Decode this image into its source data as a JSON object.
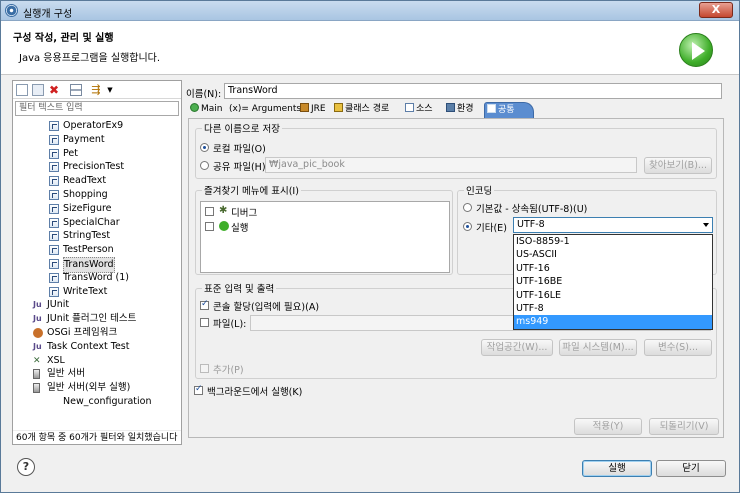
{
  "window": {
    "title": "실행개 구성",
    "close_label": "X"
  },
  "header": {
    "title": "구성 작성, 관리 및 실행",
    "subtitle": "Java 응용프로그램을 실행합니다."
  },
  "left": {
    "filter_placeholder": "필터 텍스트 입력",
    "items": [
      {
        "label": "OperatorEx9",
        "type": "java"
      },
      {
        "label": "Payment",
        "type": "java"
      },
      {
        "label": "Pet",
        "type": "java"
      },
      {
        "label": "PrecisionTest",
        "type": "java"
      },
      {
        "label": "ReadText",
        "type": "java"
      },
      {
        "label": "Shopping",
        "type": "java"
      },
      {
        "label": "SizeFigure",
        "type": "java"
      },
      {
        "label": "SpecialChar",
        "type": "java"
      },
      {
        "label": "StringTest",
        "type": "java"
      },
      {
        "label": "TestPerson",
        "type": "java"
      },
      {
        "label": "TransWord",
        "type": "java",
        "selected": true
      },
      {
        "label": "TransWord (1)",
        "type": "java"
      },
      {
        "label": "WriteText",
        "type": "java"
      },
      {
        "label": "JUnit",
        "type": "junit",
        "top": true
      },
      {
        "label": "JUnit 플러그인 테스트",
        "type": "junit-plugin",
        "top": true
      },
      {
        "label": "OSGi 프레임워크",
        "type": "osgi",
        "top": true
      },
      {
        "label": "Task Context Test",
        "type": "junit",
        "top": true
      },
      {
        "label": "XSL",
        "type": "xsl",
        "top": true
      },
      {
        "label": "일반 서버",
        "type": "server",
        "top": true
      },
      {
        "label": "일반 서버(외부 실행)",
        "type": "server",
        "top": true
      },
      {
        "label": "New_configuration",
        "type": "server-child"
      }
    ],
    "status": "60개 항목 중 60개가 필터와 일치했습니다"
  },
  "config": {
    "name_label": "이름(N):",
    "name_value": "TransWord",
    "tabs": [
      "Main",
      "(x)= Arguments",
      "JRE",
      "클래스 경로",
      "소스",
      "환경",
      "공통"
    ],
    "active_tab": 6,
    "save_as": {
      "legend": "다른 이름으로 저장",
      "local_label": "로컬 파일(O)",
      "shared_label": "공유 파일(H):",
      "shared_path": "₩java_pic_book",
      "browse_label": "찾아보기(B)..."
    },
    "favorites": {
      "legend": "즐겨찾기 메뉴에 표시(I)",
      "items": [
        {
          "label": "디버그",
          "icon": "debug-icon",
          "checked": false
        },
        {
          "label": "실행",
          "icon": "run-icon",
          "checked": false
        }
      ]
    },
    "encoding": {
      "legend": "인코딩",
      "default_label": "기본값 - 상속됨(UTF-8)(U)",
      "other_label": "기타(E)",
      "selected": "UTF-8",
      "options": [
        "ISO-8859-1",
        "US-ASCII",
        "UTF-16",
        "UTF-16BE",
        "UTF-16LE",
        "UTF-8",
        "ms949"
      ],
      "highlighted": "ms949"
    },
    "stdio": {
      "legend": "표준 입력 및 출력",
      "console_label": "콘솔 할당(입력에 필요)(A)",
      "file_label": "파일(L):",
      "workspace_label": "작업공간(W)...",
      "filesystem_label": "파일 시스템(M)...",
      "variables_label": "변수(S)...",
      "append_label": "추가(P)"
    },
    "background_label": "백그라운드에서 실행(K)",
    "apply_label": "적용(Y)",
    "revert_label": "되돌리기(V)"
  },
  "footer": {
    "help_label": "?",
    "run_label": "실행",
    "close_label": "닫기"
  }
}
